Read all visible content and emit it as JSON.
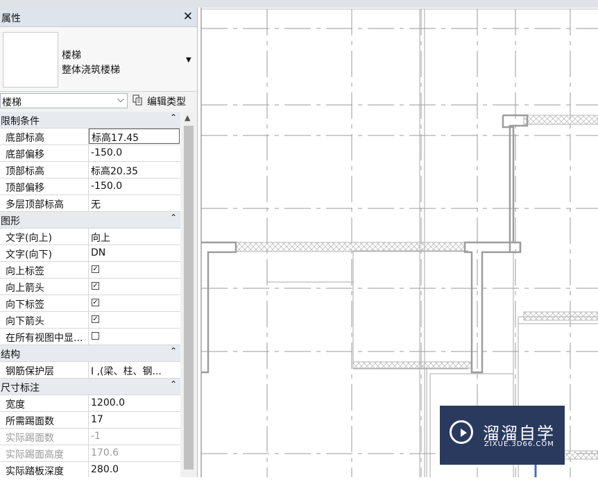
{
  "panel": {
    "title": "属性",
    "close_glyph": "✕",
    "type_selector": {
      "family": "楼梯",
      "type": "整体浇筑楼梯"
    },
    "instance_filter": "楼梯",
    "edit_type_label": "编辑类型"
  },
  "sections": [
    {
      "label": "限制条件",
      "rows": [
        {
          "name": "底部标高",
          "value": "标高17.45",
          "active": true
        },
        {
          "name": "底部偏移",
          "value": "-150.0"
        },
        {
          "name": "顶部标高",
          "value": "标高20.35"
        },
        {
          "name": "顶部偏移",
          "value": "-150.0"
        },
        {
          "name": "多层顶部标高",
          "value": "无"
        }
      ]
    },
    {
      "label": "图形",
      "rows": [
        {
          "name": "文字(向上)",
          "value": "向上"
        },
        {
          "name": "文字(向下)",
          "value": "DN"
        },
        {
          "name": "向上标签",
          "checked": true
        },
        {
          "name": "向上箭头",
          "checked": true
        },
        {
          "name": "向下标签",
          "checked": true
        },
        {
          "name": "向下箭头",
          "checked": true
        },
        {
          "name": "在所有视图中显...",
          "checked": false
        }
      ]
    },
    {
      "label": "结构",
      "rows": [
        {
          "name": "钢筋保护层",
          "value": "I ,(梁、柱、钢..."
        }
      ]
    },
    {
      "label": "尺寸标注",
      "rows": [
        {
          "name": "宽度",
          "value": "1200.0"
        },
        {
          "name": "所需踢面数",
          "value": "17"
        },
        {
          "name": "实际踢面数",
          "value": "-1",
          "disabled": true
        },
        {
          "name": "实际踢面高度",
          "value": "170.6",
          "disabled": true
        },
        {
          "name": "实际踏板深度",
          "value": "280.0"
        }
      ]
    }
  ],
  "watermark": {
    "title": "溜溜自学",
    "subtitle": "ZIXUE.3D66.COM"
  }
}
